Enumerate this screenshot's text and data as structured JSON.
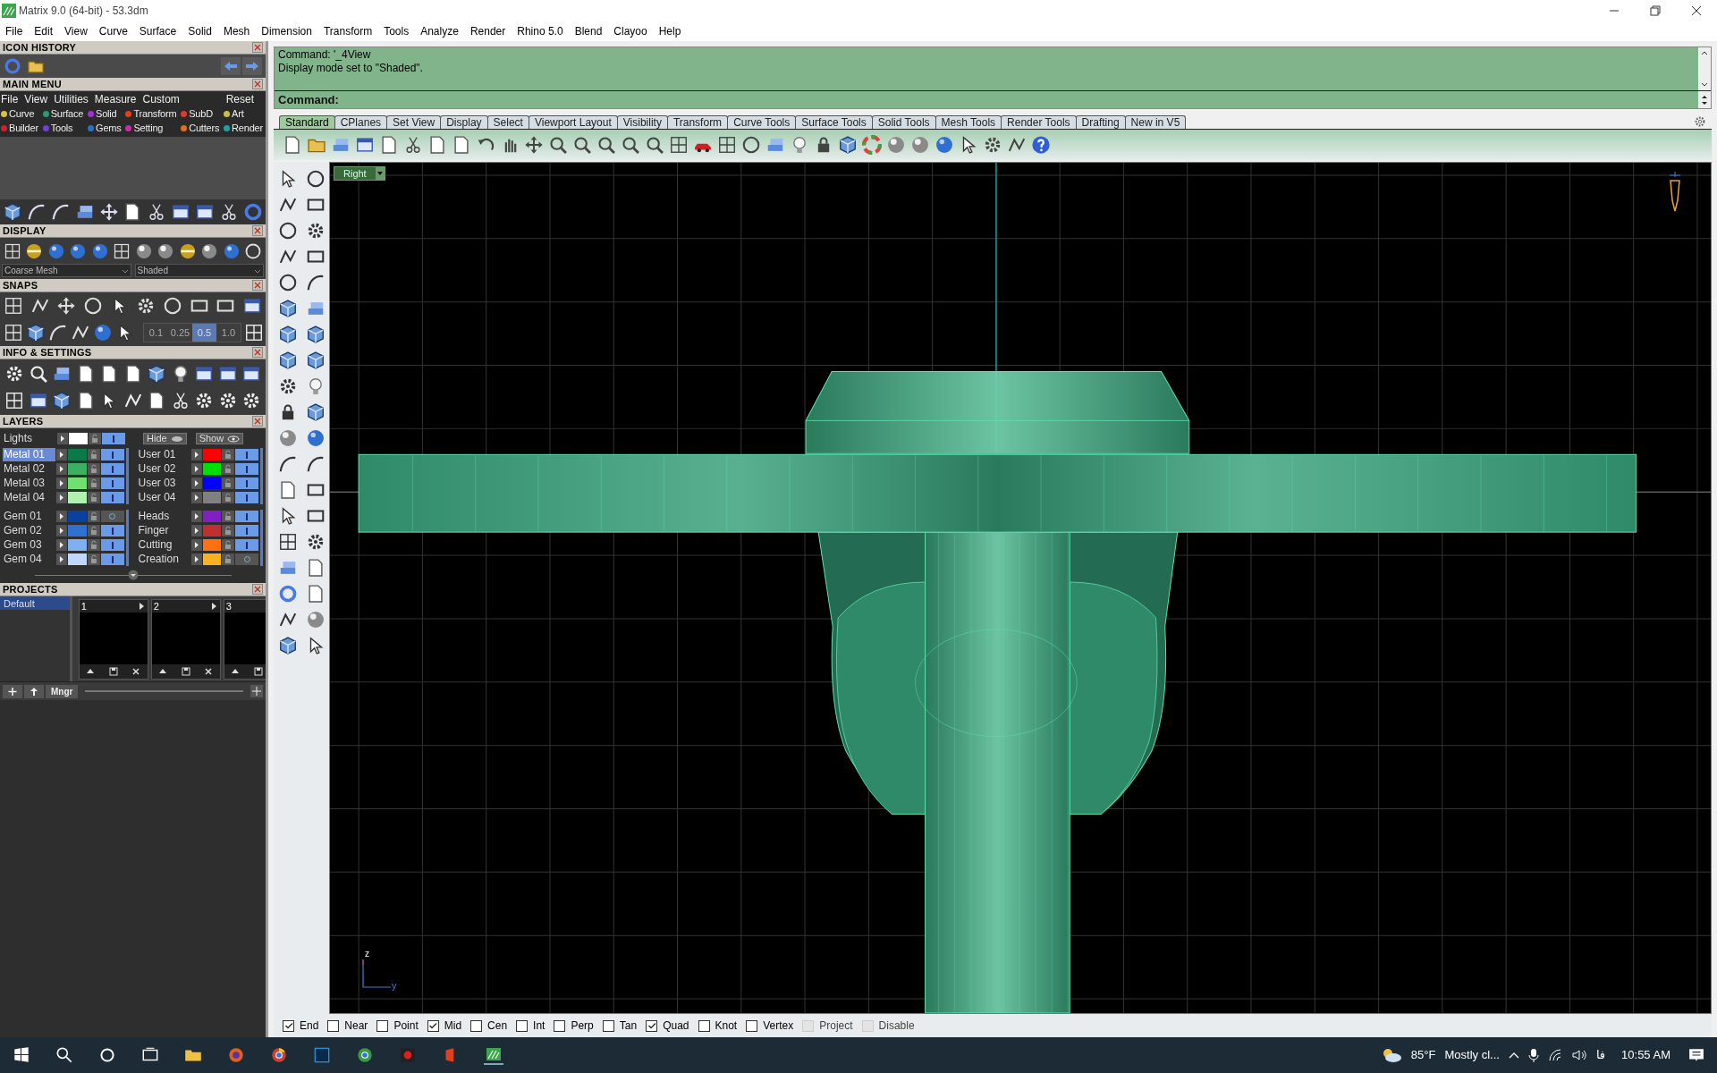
{
  "window": {
    "title": "Matrix 9.0 (64-bit) - 53.3dm"
  },
  "menu_bar": [
    "File",
    "Edit",
    "View",
    "Curve",
    "Surface",
    "Solid",
    "Mesh",
    "Dimension",
    "Transform",
    "Tools",
    "Analyze",
    "Render",
    "Rhino 5.0",
    "Blend",
    "Clayoo",
    "Help"
  ],
  "icon_history": {
    "title": "ICON HISTORY"
  },
  "main_menu": {
    "title": "MAIN MENU",
    "top_items": [
      "File",
      "View",
      "Utilities",
      "Measure",
      "Custom"
    ],
    "reset": "Reset",
    "categories": [
      {
        "label": "Curve",
        "color": "#d8c040"
      },
      {
        "label": "Surface",
        "color": "#2a9a70"
      },
      {
        "label": "Solid",
        "color": "#a030d0"
      },
      {
        "label": "Transform",
        "color": "#e04020"
      },
      {
        "label": "SubD",
        "color": "#e03a30"
      },
      {
        "label": "Art",
        "color": "#c8c040"
      },
      {
        "label": "Builder",
        "color": "#d02030"
      },
      {
        "label": "Tools",
        "color": "#7040d0"
      },
      {
        "label": "Gems",
        "color": "#3070c0"
      },
      {
        "label": "Setting",
        "color": "#c030a0"
      },
      {
        "label": "Cutters",
        "color": "#e07020"
      },
      {
        "label": "Render",
        "color": "#20a0a0"
      }
    ]
  },
  "display": {
    "title": "DISPLAY",
    "mesh_mode": "Coarse Mesh",
    "shade_mode": "Shaded"
  },
  "snaps": {
    "title": "SNAPS",
    "values": [
      {
        "label": "0.1",
        "selected": false
      },
      {
        "label": "0.25",
        "selected": false
      },
      {
        "label": "0.5",
        "selected": true
      },
      {
        "label": "1.0",
        "selected": false
      }
    ]
  },
  "info_settings": {
    "title": "INFO & SETTINGS"
  },
  "layers": {
    "title": "LAYERS",
    "lights": {
      "name": "Lights",
      "color": "#ffffff",
      "on": true
    },
    "hide": "Hide",
    "show": "Show",
    "columns": [
      {
        "groups": [
          [
            {
              "name": "Metal 01",
              "color": "#0a7a4a",
              "selected": true,
              "on": true
            },
            {
              "name": "Metal 02",
              "color": "#3cb060",
              "selected": false,
              "on": true
            },
            {
              "name": "Metal 03",
              "color": "#70e070",
              "selected": false,
              "on": true
            },
            {
              "name": "Metal 04",
              "color": "#b0f0b0",
              "selected": false,
              "on": true
            }
          ],
          [
            {
              "name": "Gem 01",
              "color": "#0a40a0",
              "selected": false,
              "on": false
            },
            {
              "name": "Gem 02",
              "color": "#3070d0",
              "selected": false,
              "on": true
            },
            {
              "name": "Gem 03",
              "color": "#80b0f0",
              "selected": false,
              "on": true
            },
            {
              "name": "Gem 04",
              "color": "#c0d8ff",
              "selected": false,
              "on": true
            }
          ]
        ]
      },
      {
        "groups": [
          [
            {
              "name": "User 01",
              "color": "#ff0000",
              "selected": false,
              "on": true
            },
            {
              "name": "User 02",
              "color": "#00e000",
              "selected": false,
              "on": true
            },
            {
              "name": "User 03",
              "color": "#0000ff",
              "selected": false,
              "on": true
            },
            {
              "name": "User 04",
              "color": "#808080",
              "selected": false,
              "on": true
            }
          ],
          [
            {
              "name": "Heads",
              "color": "#8020c0",
              "selected": false,
              "on": true
            },
            {
              "name": "Finger",
              "color": "#c03030",
              "selected": false,
              "on": true
            },
            {
              "name": "Cutting",
              "color": "#ff7010",
              "selected": false,
              "on": true
            },
            {
              "name": "Creation",
              "color": "#ffb020",
              "selected": false,
              "on": false
            }
          ]
        ]
      }
    ]
  },
  "projects": {
    "title": "PROJECTS",
    "list": [
      {
        "name": "Default",
        "selected": true
      }
    ],
    "thumbnails": [
      "1",
      "2",
      "3"
    ],
    "manager": "Mngr"
  },
  "command": {
    "history": [
      "Command: '_4View",
      "Display mode set to \"Shaded\"."
    ],
    "prompt": "Command:"
  },
  "toolbar_tabs": [
    {
      "label": "Standard",
      "selected": true
    },
    {
      "label": "CPlanes",
      "selected": false
    },
    {
      "label": "Set View",
      "selected": false
    },
    {
      "label": "Display",
      "selected": false
    },
    {
      "label": "Select",
      "selected": false
    },
    {
      "label": "Viewport Layout",
      "selected": false
    },
    {
      "label": "Visibility",
      "selected": false
    },
    {
      "label": "Transform",
      "selected": false
    },
    {
      "label": "Curve Tools",
      "selected": false
    },
    {
      "label": "Surface Tools",
      "selected": false
    },
    {
      "label": "Solid Tools",
      "selected": false
    },
    {
      "label": "Mesh Tools",
      "selected": false
    },
    {
      "label": "Render Tools",
      "selected": false
    },
    {
      "label": "Drafting",
      "selected": false
    },
    {
      "label": "New in V5",
      "selected": false
    }
  ],
  "viewport": {
    "label": "Right",
    "axes": [
      "z",
      "y"
    ]
  },
  "osnaps": [
    {
      "label": "End",
      "checked": true,
      "disabled": false
    },
    {
      "label": "Near",
      "checked": false,
      "disabled": false
    },
    {
      "label": "Point",
      "checked": false,
      "disabled": false
    },
    {
      "label": "Mid",
      "checked": true,
      "disabled": false
    },
    {
      "label": "Cen",
      "checked": false,
      "disabled": false
    },
    {
      "label": "Int",
      "checked": false,
      "disabled": false
    },
    {
      "label": "Perp",
      "checked": false,
      "disabled": false
    },
    {
      "label": "Tan",
      "checked": false,
      "disabled": false
    },
    {
      "label": "Quad",
      "checked": true,
      "disabled": false
    },
    {
      "label": "Knot",
      "checked": false,
      "disabled": false
    },
    {
      "label": "Vertex",
      "checked": false,
      "disabled": false
    },
    {
      "label": "Project",
      "checked": false,
      "disabled": true
    },
    {
      "label": "Disable",
      "checked": false,
      "disabled": true
    }
  ],
  "taskbar": {
    "weather_temp": "85°F",
    "weather_text": "Mostly cl...",
    "language": "فا",
    "time": "10:55 AM"
  }
}
